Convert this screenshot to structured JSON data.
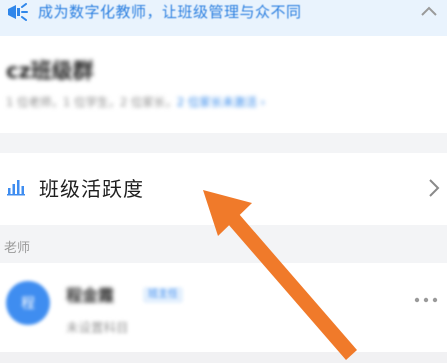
{
  "banner": {
    "text": "成为数字化教师，让班级管理与众不同",
    "icon": "megaphone-icon",
    "close_icon": "chevron-up-icon"
  },
  "group": {
    "name": "cz班级群",
    "summary": "1 位老师，1 位学生，2 位家长，",
    "invite_link": "2 位家长未激活 ›"
  },
  "activity": {
    "label": "班级活跃度",
    "icon": "bar-chart-icon",
    "chevron_icon": "chevron-right-icon"
  },
  "teachers_section": {
    "title": "老师",
    "members": [
      {
        "avatar_text": "程",
        "name": "程金霞",
        "badge": "班主任",
        "subject": "未设置科目",
        "more_icon": "more-dots-icon"
      }
    ]
  },
  "annotation": {
    "arrow_color": "#f07a2a"
  },
  "colors": {
    "accent": "#2f86ea",
    "banner_bg": "#e9f3fd",
    "section_bg": "#f3f4f6"
  }
}
